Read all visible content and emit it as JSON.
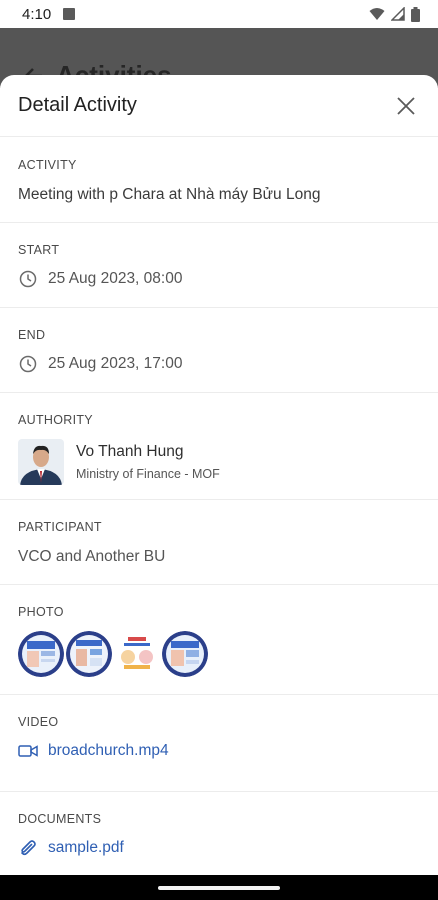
{
  "status_bar": {
    "time": "4:10"
  },
  "background": {
    "title": "Activities"
  },
  "sheet": {
    "title": "Detail Activity",
    "activity": {
      "label": "ACTIVITY",
      "value": "Meeting with p Chara at Nhà máy Bửu Long"
    },
    "start": {
      "label": "START",
      "value": "25 Aug 2023, 08:00"
    },
    "end": {
      "label": "END",
      "value": "25 Aug 2023, 17:00"
    },
    "authority": {
      "label": "AUTHORITY",
      "name": "Vo Thanh Hung",
      "organization": "Ministry of Finance - MOF"
    },
    "participant": {
      "label": "PARTICIPANT",
      "value": "VCO and Another BU"
    },
    "photo": {
      "label": "PHOTO",
      "count": 4
    },
    "video": {
      "label": "VIDEO",
      "file": "broadchurch.mp4"
    },
    "documents": {
      "label": "DOCUMENTS",
      "file": "sample.pdf"
    }
  },
  "colors": {
    "link": "#2f5fb3",
    "scrim": "#555555",
    "divider": "#ececec"
  },
  "icons": [
    "clock-icon",
    "video-camera-icon",
    "paperclip-icon",
    "close-icon",
    "back-arrow-icon",
    "wifi-icon",
    "signal-icon",
    "battery-icon"
  ]
}
